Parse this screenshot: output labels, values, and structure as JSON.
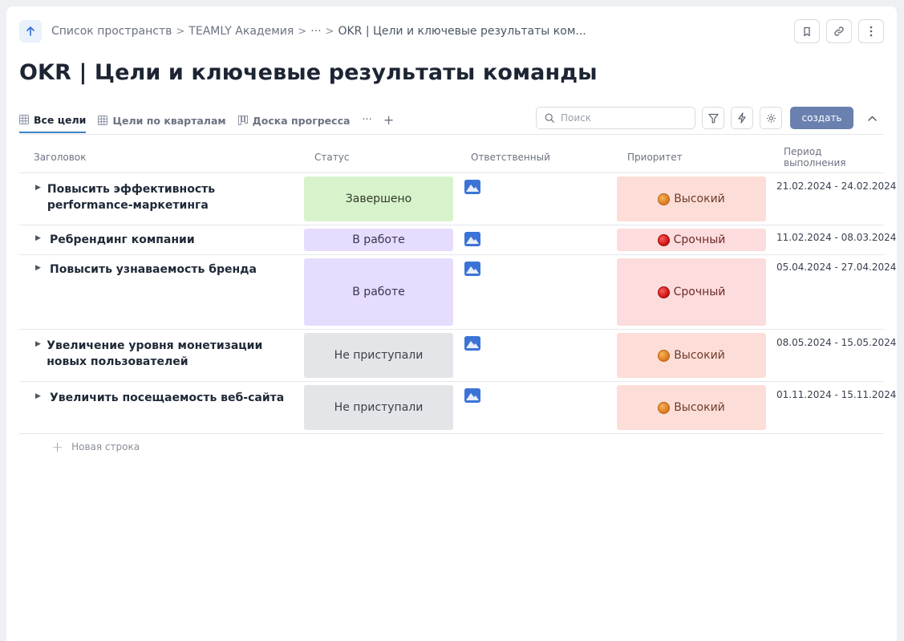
{
  "breadcrumb": {
    "items": [
      "Список пространств",
      "TEAMLY Академия",
      "···",
      "OKR | Цели и ключевые результаты ком..."
    ],
    "separator": ">"
  },
  "page": {
    "title": "OKR | Цели и ключевые результаты команды"
  },
  "tabs": [
    {
      "label": "Все цели",
      "icon": "table-icon",
      "active": true
    },
    {
      "label": "Цели по кварталам",
      "icon": "table-icon",
      "active": false
    },
    {
      "label": "Доска прогресса",
      "icon": "board-icon",
      "active": false
    }
  ],
  "tabs_more": "···",
  "tabs_add": "+",
  "toolbar": {
    "search_placeholder": "Поиск",
    "create_label": "создать"
  },
  "table": {
    "headers": [
      "Заголовок",
      "Статус",
      "Ответственный",
      "Приоритет",
      "Период выполнения"
    ],
    "rows": [
      {
        "title": "Повысить эффективность performance-маркетинга",
        "status": "Завершено",
        "status_kind": "done",
        "priority": "Высокий",
        "priority_kind": "high",
        "period": "21.02.2024 - 24.02.2024"
      },
      {
        "title": "Ребрендинг компании",
        "status": "В работе",
        "status_kind": "work",
        "priority": "Срочный",
        "priority_kind": "urgent",
        "period": "11.02.2024 - 08.03.2024"
      },
      {
        "title": "Повысить узнаваемость бренда",
        "status": "В работе",
        "status_kind": "work",
        "priority": "Срочный",
        "priority_kind": "urgent",
        "period": "05.04.2024 - 27.04.2024"
      },
      {
        "title": "Увеличение уровня монетизации новых пользователей",
        "status": "Не приступали",
        "status_kind": "none",
        "priority": "Высокий",
        "priority_kind": "high",
        "period": "08.05.2024 - 15.05.2024"
      },
      {
        "title": "Увеличить посещаемость веб-сайта",
        "status": "Не приступали",
        "status_kind": "none",
        "priority": "Высокий",
        "priority_kind": "high",
        "period": "01.11.2024 - 15.11.2024"
      }
    ],
    "new_row_label": "Новая строка"
  },
  "colors": {
    "accent": "#6a80ae",
    "status_done": "#d8f3cc",
    "status_work": "#e6dcfd",
    "status_none": "#e3e5e8",
    "priority_high": "#fcddd7",
    "priority_urgent": "#fcdcdc"
  }
}
